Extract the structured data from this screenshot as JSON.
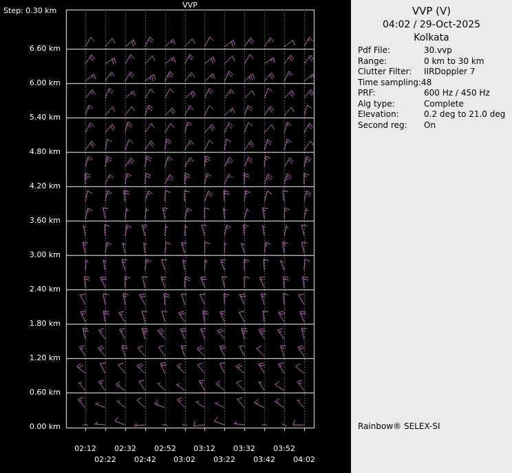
{
  "chart": {
    "title": "VVP",
    "step_label": "Step: 0.30 km",
    "y_labels": [
      "6.60 km",
      "6.00 km",
      "5.40 km",
      "4.80 km",
      "4.20 km",
      "3.60 km",
      "3.00 km",
      "2.40 km",
      "1.80 km",
      "1.20 km",
      "0.60 km",
      "0.00 km"
    ],
    "x_labels_row1": [
      "02:12",
      "02:32",
      "02:52",
      "03:12",
      "03:32",
      "03:52"
    ],
    "x_labels_row2": [
      "02:22",
      "02:42",
      "03:02",
      "03:22",
      "03:42",
      "04:02"
    ],
    "colors": {
      "background": "#000000",
      "grid": "#ffffff",
      "grid_dotted": "#bbbbbb",
      "barb": "#d285d2",
      "text": "#ffffff"
    }
  },
  "panel": {
    "title": "VVP (V)",
    "datetime": "04:02 / 29-Oct-2025",
    "site": "Kolkata",
    "params": [
      {
        "label": "Pdf File:",
        "value": "30.vvp"
      },
      {
        "label": "Range:",
        "value": "0 km to 30 km"
      },
      {
        "label": "Clutter Filter:",
        "value": "IIRDoppler 7"
      },
      {
        "label": "Time sampling:48",
        "value": ""
      },
      {
        "label": "PRF:",
        "value": "600 Hz / 450 Hz"
      },
      {
        "label": "Alg type:",
        "value": "Complete"
      },
      {
        "label": "Elevation:",
        "value": "0.2 deg to 21.0 deg"
      },
      {
        "label": "Second reg:",
        "value": "On"
      }
    ],
    "footer": "Rainbow® SELEX-SI"
  },
  "chart_data": {
    "type": "wind-barb-profile",
    "title": "VVP",
    "x_times": [
      "02:12",
      "02:22",
      "02:32",
      "02:42",
      "02:52",
      "03:02",
      "03:12",
      "03:22",
      "03:32",
      "03:42",
      "03:52",
      "04:02"
    ],
    "height_step_km": 0.3,
    "height_range_km": [
      0.0,
      6.6
    ],
    "barb_color": "#d285d2",
    "levels": [
      {
        "h": 6.6,
        "ang": -50,
        "spd": 15
      },
      {
        "h": 6.3,
        "ang": -48,
        "spd": 15
      },
      {
        "h": 6.0,
        "ang": -52,
        "spd": 20
      },
      {
        "h": 5.7,
        "ang": -55,
        "spd": 15
      },
      {
        "h": 5.4,
        "ang": -58,
        "spd": 15
      },
      {
        "h": 5.1,
        "ang": -62,
        "spd": 15
      },
      {
        "h": 4.8,
        "ang": -68,
        "spd": 15
      },
      {
        "h": 4.5,
        "ang": -72,
        "spd": 20
      },
      {
        "h": 4.2,
        "ang": -78,
        "spd": 20
      },
      {
        "h": 3.9,
        "ang": -84,
        "spd": 15
      },
      {
        "h": 3.6,
        "ang": -88,
        "spd": 10
      },
      {
        "h": 3.3,
        "ang": -92,
        "spd": 10
      },
      {
        "h": 3.0,
        "ang": -95,
        "spd": 10
      },
      {
        "h": 2.7,
        "ang": -98,
        "spd": 10
      },
      {
        "h": 2.4,
        "ang": -102,
        "spd": 15
      },
      {
        "h": 2.1,
        "ang": -106,
        "spd": 15
      },
      {
        "h": 1.8,
        "ang": -112,
        "spd": 15
      },
      {
        "h": 1.5,
        "ang": -118,
        "spd": 20
      },
      {
        "h": 1.2,
        "ang": -122,
        "spd": 15
      },
      {
        "h": 0.9,
        "ang": -128,
        "spd": 15
      },
      {
        "h": 0.6,
        "ang": -134,
        "spd": 10
      },
      {
        "h": 0.3,
        "ang": -145,
        "spd": 10
      },
      {
        "h": 0.0,
        "ang": -172,
        "spd": 5
      }
    ]
  }
}
